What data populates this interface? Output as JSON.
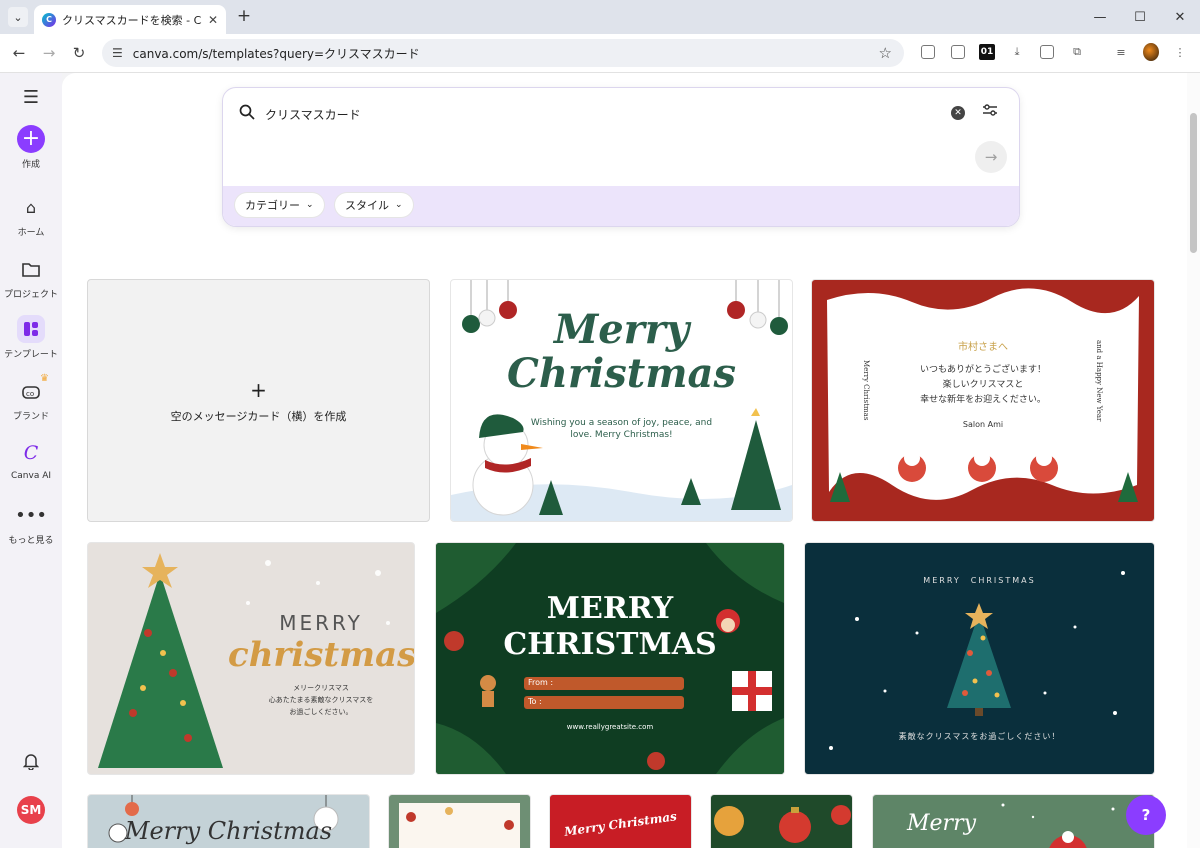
{
  "browser": {
    "tab_title": "クリスマスカードを検索 - Canva",
    "url": "canva.com/s/templates?query=クリスマスカード",
    "new_tab": "+",
    "tab_close": "✕"
  },
  "sidebar": {
    "items": [
      {
        "label": "作成",
        "icon": "plus-icon"
      },
      {
        "label": "ホーム",
        "icon": "home-icon"
      },
      {
        "label": "プロジェクト",
        "icon": "folder-icon"
      },
      {
        "label": "テンプレート",
        "icon": "template-icon"
      },
      {
        "label": "ブランド",
        "icon": "brand-icon"
      },
      {
        "label": "Canva AI",
        "icon": "canva-ai-icon"
      },
      {
        "label": "もっと見る",
        "icon": "more-icon"
      }
    ],
    "avatar_initials": "SM"
  },
  "search": {
    "query": "クリスマスカード",
    "chips": [
      {
        "label": "カテゴリー"
      },
      {
        "label": "スタイル"
      }
    ]
  },
  "blank_card": {
    "label": "空のメッセージカード（横）を作成"
  },
  "templates": {
    "t1": {
      "title_line1": "Merry",
      "title_line2": "Christmas",
      "subtitle": "Wishing you a season of joy, peace, and",
      "subtitle2": "love. Merry Christmas!"
    },
    "t2": {
      "to": "市村さまへ",
      "line1": "いつもありがとうございます！",
      "line2": "楽しいクリスマスと",
      "line3": "幸せな新年をお迎えください。",
      "sign": "Salon Ami",
      "left_vertical": "Merry Christmas",
      "right_vertical": "and a Happy New Year"
    },
    "t3": {
      "title_line1": "MERRY",
      "title_line2": "christmas",
      "sub1": "メリークリスマス",
      "sub2": "心あたたまる素敵なクリスマスを",
      "sub3": "お過ごしください。"
    },
    "t4": {
      "title_line1": "MERRY",
      "title_line2": "CHRISTMAS",
      "from": "From :",
      "to": "To :",
      "site": "www.reallygreatsite.com"
    },
    "t5": {
      "header": "MERRY　CHRISTMAS",
      "footer": "素敵なクリスマスをお過ごしください！"
    },
    "t6": {
      "title": "Merry Christmas"
    },
    "t8": {
      "title": "Merry Christmas"
    },
    "t10": {
      "title": "Merry"
    }
  },
  "help_label": "?"
}
